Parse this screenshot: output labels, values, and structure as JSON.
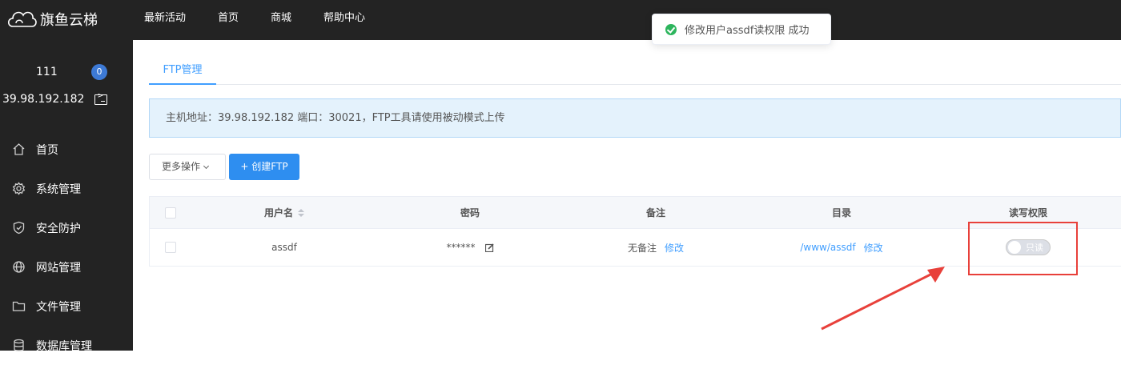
{
  "brand": {
    "name": "旗鱼云梯",
    "logo_icon": "cloud-icon"
  },
  "topnav": [
    "最新活动",
    "首页",
    "商城",
    "帮助中心"
  ],
  "sidebar": {
    "user_name": "111",
    "badge_count": "0",
    "ip": "39.98.192.182",
    "items": [
      {
        "label": "首页",
        "icon": "home-icon"
      },
      {
        "label": "系统管理",
        "icon": "gear-icon"
      },
      {
        "label": "安全防护",
        "icon": "shield-icon"
      },
      {
        "label": "网站管理",
        "icon": "globe-icon"
      },
      {
        "label": "文件管理",
        "icon": "folder-icon"
      },
      {
        "label": "数据库管理",
        "icon": "database-icon"
      }
    ]
  },
  "tabs": [
    {
      "label": "FTP管理",
      "active": true
    }
  ],
  "notice": "主机地址：39.98.192.182 端口：30021，FTP工具请使用被动模式上传",
  "toolbar": {
    "more_label": "更多操作",
    "create_label": "+ 创建FTP"
  },
  "table": {
    "headers": [
      "用户名",
      "密码",
      "备注",
      "目录",
      "读写权限"
    ],
    "rows": [
      {
        "username": "assdf",
        "password": "******",
        "remark": "无备注",
        "remark_action": "修改",
        "directory": "/www/assdf",
        "directory_action": "修改",
        "permission": "只读"
      }
    ]
  },
  "toast": {
    "message": "修改用户assdf读权限 成功",
    "type": "success"
  },
  "colors": {
    "primary": "#409eff",
    "topbar": "#232323",
    "success": "#2db55d",
    "annotation": "#e8403a"
  }
}
